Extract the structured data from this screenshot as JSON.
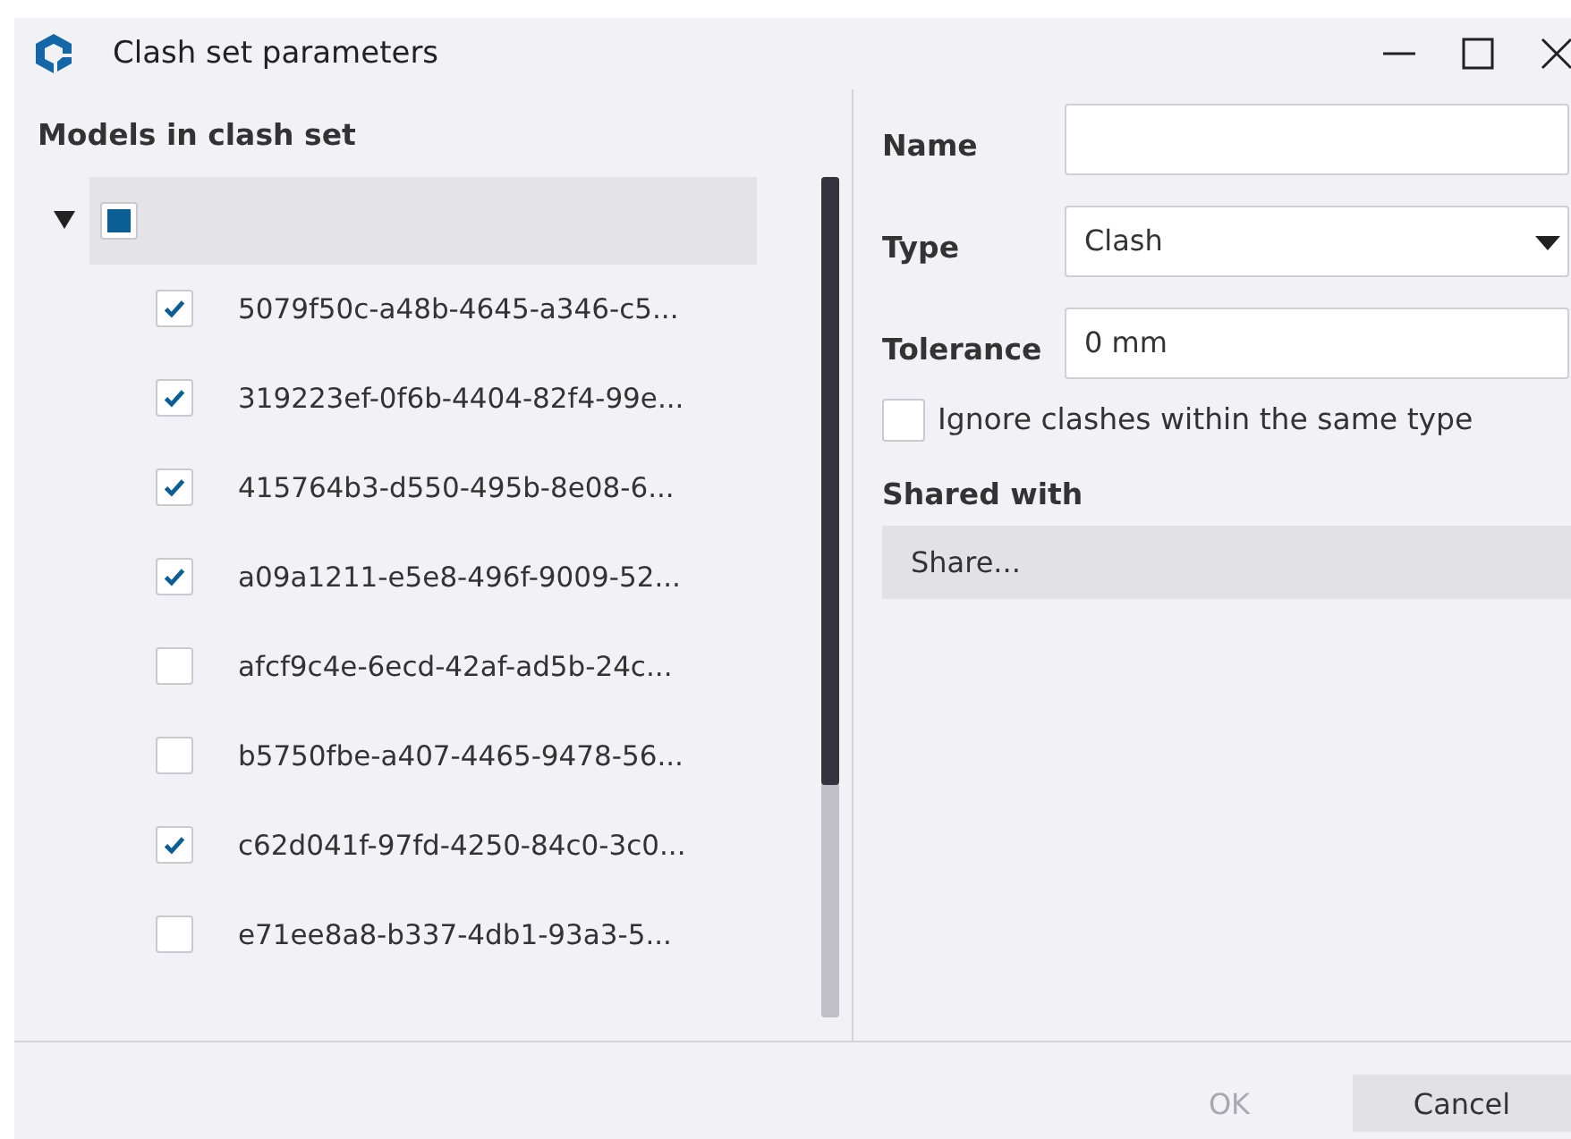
{
  "window": {
    "title": "Clash set parameters"
  },
  "models": {
    "heading": "Models in clash set",
    "root": {
      "expanded": true,
      "indeterminate": true,
      "children": [
        {
          "label": "5079f50c-a48b-4645-a346-c5...",
          "checked": true
        },
        {
          "label": "319223ef-0f6b-4404-82f4-99e...",
          "checked": true
        },
        {
          "label": "415764b3-d550-495b-8e08-6...",
          "checked": true
        },
        {
          "label": "a09a1211-e5e8-496f-9009-52...",
          "checked": true
        },
        {
          "label": "afcf9c4e-6ecd-42af-ad5b-24c...",
          "checked": false
        },
        {
          "label": "b5750fbe-a407-4465-9478-56...",
          "checked": false
        },
        {
          "label": "c62d041f-97fd-4250-84c0-3c0...",
          "checked": true
        },
        {
          "label": "e71ee8a8-b337-4db1-93a3-5...",
          "checked": false
        }
      ]
    }
  },
  "form": {
    "name_label": "Name",
    "type_label": "Type",
    "type_value": "Clash",
    "tolerance_label": "Tolerance",
    "tolerance_value": "0 mm",
    "ignore": {
      "label": "Ignore clashes within the same type",
      "checked": false
    },
    "shared_label": "Shared with",
    "share_button": "Share..."
  },
  "buttons": [
    {
      "label": "OK",
      "disabled": true
    },
    {
      "label": "Cancel",
      "disabled": false
    }
  ]
}
